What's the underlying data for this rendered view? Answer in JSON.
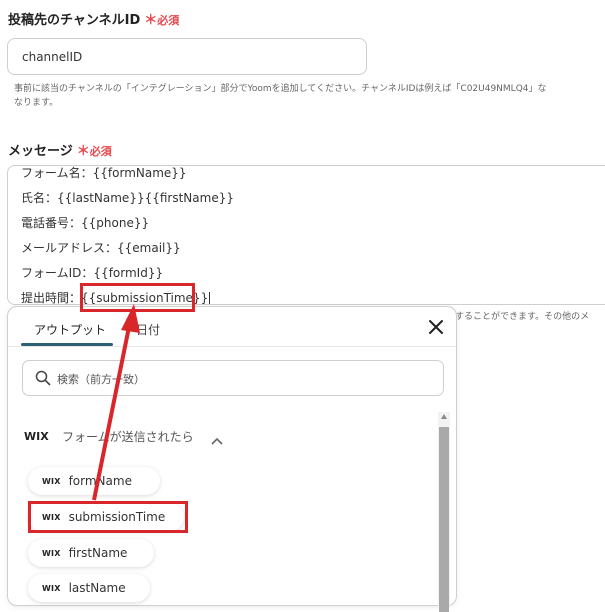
{
  "channel_field": {
    "label": "投稿先のチャンネルID",
    "required_mark": "＊",
    "required_text": "必須",
    "value": "channelID",
    "hint_line1": "事前に該当のチャンネルの「インテグレーション」部分でYoomを追加してください。チャンネルIDは例えば「C02U49NMLQ4」な",
    "hint_line2": "なります。"
  },
  "message_field": {
    "label": "メッセージ",
    "required_mark": "＊",
    "required_text": "必須",
    "lines": [
      "フォーム名：{{formName}}",
      "氏名：{{lastName}}{{firstName}}",
      "電話番号：{{phone}}",
      "メールアドレス：{{email}}",
      "フォームID：{{formId}}"
    ],
    "last_line_prefix": "提出時間：",
    "last_line_token": "{{submissionTime}}",
    "hint_partial": "することができます。その他のメ"
  },
  "popup": {
    "tabs": [
      {
        "label": "アウトプット",
        "active": true
      },
      {
        "label": "日付",
        "active": false
      }
    ],
    "search_placeholder": "検索（前方一致）",
    "section_logo": "WIX",
    "section_title": "フォームが送信されたら",
    "items": [
      {
        "logo": "WIX",
        "label": "formName"
      },
      {
        "logo": "WIX",
        "label": "submissionTime"
      },
      {
        "logo": "WIX",
        "label": "firstName"
      },
      {
        "logo": "WIX",
        "label": "lastName"
      }
    ]
  },
  "colors": {
    "required": "#e5484d",
    "annotation": "#d9262a",
    "tab_underline": "#2b5f73"
  }
}
